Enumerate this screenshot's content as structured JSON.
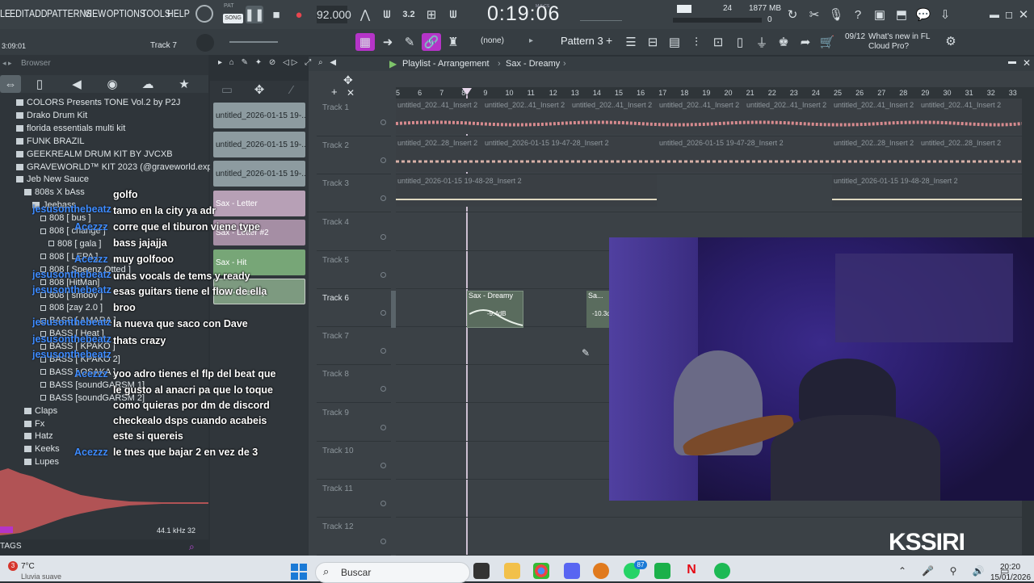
{
  "menu": [
    "LE",
    "EDIT",
    "ADD",
    "PATTERNS",
    "VIEW",
    "OPTIONS",
    "TOOLS",
    "HELP"
  ],
  "transport": {
    "pat": "PAT",
    "song": "SONG",
    "tempo": "92.000",
    "time": "0:19:06",
    "time_label": "M:S:CS",
    "cpu": "24",
    "mem": "1877 MB",
    "mem2": "0"
  },
  "hint": {
    "time": "3:09:01",
    "track": "Track 7"
  },
  "pattern": {
    "snap": "(none)",
    "name": "Pattern 3",
    "news_count": "09/12",
    "news": "What's new in FL Cloud Pro?"
  },
  "browser": {
    "title": "Browser",
    "items": [
      {
        "label": "COLORS Presents TONE Vol.2 by P2J",
        "indent": 0,
        "type": "folder"
      },
      {
        "label": "Drako Drum Kit",
        "indent": 0,
        "type": "folder"
      },
      {
        "label": "florida essentials multi kit",
        "indent": 0,
        "type": "folder"
      },
      {
        "label": "FUNK BRAZIL",
        "indent": 0,
        "type": "folder"
      },
      {
        "label": "GEEKREALM DRUM KIT BY JVCXB",
        "indent": 0,
        "type": "folder"
      },
      {
        "label": "GRAVEWORLD™ KIT 2023 (@graveworld.experiment)",
        "indent": 0,
        "type": "folder"
      },
      {
        "label": "Jeb New Sauce",
        "indent": 0,
        "type": "folder"
      },
      {
        "label": "808s X bAss",
        "indent": 1,
        "type": "folder"
      },
      {
        "label": "Jeebass",
        "indent": 2,
        "type": "folder"
      },
      {
        "label": "808 [ bus ]",
        "indent": 3,
        "type": "file"
      },
      {
        "label": "808 [ change ]",
        "indent": 3,
        "type": "file"
      },
      {
        "label": "808 [ gala ]",
        "indent": 4,
        "type": "file"
      },
      {
        "label": "808 [ LEPA ]",
        "indent": 3,
        "type": "file"
      },
      {
        "label": "808 [ Speenz Otted ]",
        "indent": 3,
        "type": "file"
      },
      {
        "label": "808 [HitMan]",
        "indent": 3,
        "type": "file"
      },
      {
        "label": "808 [ smoov ]",
        "indent": 3,
        "type": "file"
      },
      {
        "label": "808 [zay 2.0 ]",
        "indent": 3,
        "type": "file"
      },
      {
        "label": "BASS [ AMARA ]",
        "indent": 3,
        "type": "file"
      },
      {
        "label": "BASS [ Heat ]",
        "indent": 3,
        "type": "file"
      },
      {
        "label": "BASS [ KPAKO ]",
        "indent": 3,
        "type": "file"
      },
      {
        "label": "BASS [ KPAKO 2]",
        "indent": 3,
        "type": "file"
      },
      {
        "label": "BASS [ OSAKA ]",
        "indent": 3,
        "type": "file"
      },
      {
        "label": "BASS [soundGARSM 1]",
        "indent": 3,
        "type": "file"
      },
      {
        "label": "BASS [soundGARSM 2]",
        "indent": 3,
        "type": "file"
      },
      {
        "label": "Claps",
        "indent": 1,
        "type": "folder"
      },
      {
        "label": "Fx",
        "indent": 1,
        "type": "folder"
      },
      {
        "label": "Hatz",
        "indent": 1,
        "type": "folder"
      },
      {
        "label": "Keeks",
        "indent": 1,
        "type": "folder"
      },
      {
        "label": "Lupes",
        "indent": 1,
        "type": "folder"
      }
    ],
    "samplerate": "44.1 kHz 32",
    "tags": "TAGS"
  },
  "chat": [
    {
      "user": "",
      "msg": "golfo"
    },
    {
      "user": "jesusonthebeatz",
      "msg": "tamo en la city ya adr"
    },
    {
      "user": "Acezzz",
      "msg": "corre que el tiburon viene type"
    },
    {
      "user": "",
      "msg": "bass jajajja"
    },
    {
      "user": "Acezzz",
      "msg": "muy golfooo"
    },
    {
      "user": "jesusonthebeatz",
      "msg": "unas vocals de tems y ready"
    },
    {
      "user": "jesusonthebeatz",
      "msg": "esas guitars tiene el flow de ella"
    },
    {
      "user": "",
      "msg": "broo"
    },
    {
      "user": "jesusonthebeatz",
      "msg": "la nueva que saco con Dave"
    },
    {
      "user": "jesusonthebeatz",
      "msg": "thats crazy"
    },
    {
      "user": "jesusonthebeatz",
      "msg": ""
    },
    {
      "user": "Acezzz",
      "msg": "yoo adro tienes el flp del beat que"
    },
    {
      "user": "",
      "msg": "le gusto al anacri pa que lo toque"
    },
    {
      "user": "",
      "msg": "como quieras por dm de discord"
    },
    {
      "user": "",
      "msg": "checkealo dsps cuando acabeis"
    },
    {
      "user": "",
      "msg": "este si quereis"
    },
    {
      "user": "Acezzz",
      "msg": "le tnes que bajar 2 en vez de 3"
    }
  ],
  "clips": [
    "untitled_2026-01-15 19-...",
    "untitled_2026-01-15 19-...",
    "untitled_2026-01-15 19-...",
    "Sax - Letter",
    "Sax - Letter #2",
    "Sax - Hit",
    "Sax - Dreamy"
  ],
  "playlist": {
    "title": "Playlist - Arrangement",
    "pattern": "Sax - Dreamy",
    "ruler": [
      "5",
      "6",
      "7",
      "8",
      "9",
      "10",
      "11",
      "12",
      "13",
      "14",
      "15",
      "16",
      "17",
      "18",
      "19",
      "20",
      "21",
      "22",
      "23",
      "24",
      "25",
      "26",
      "27",
      "28",
      "29",
      "30",
      "31",
      "32",
      "33"
    ],
    "tracks": [
      "Track 1",
      "Track 2",
      "Track 3",
      "Track 4",
      "Track 5",
      "Track 6",
      "Track 7",
      "Track 8",
      "Track 9",
      "Track 10",
      "Track 11",
      "Track 12"
    ],
    "lane1_clip": "untitled_202..41_Insert 2",
    "lane2_clip": "untitled_202..28_Insert 2",
    "lane2_long": "untitled_2026-01-15 19-47-28_Insert 2",
    "lane3_clip": "untitled_2026-01-15 19-48-28_Insert 2",
    "sax_clip": "Sax - Dreamy",
    "sax_db": "-9.4dB",
    "sax_clip2": "Sa...",
    "sax_db2": "-10.3d"
  },
  "webcam": {
    "logo": "KSSIRI"
  },
  "taskbar": {
    "weather": "7°C",
    "weather_desc": "Lluvia suave",
    "search": "Buscar",
    "time": "20:20",
    "date": "15/01/2026",
    "notif": "3",
    "wa_badge": "87"
  }
}
